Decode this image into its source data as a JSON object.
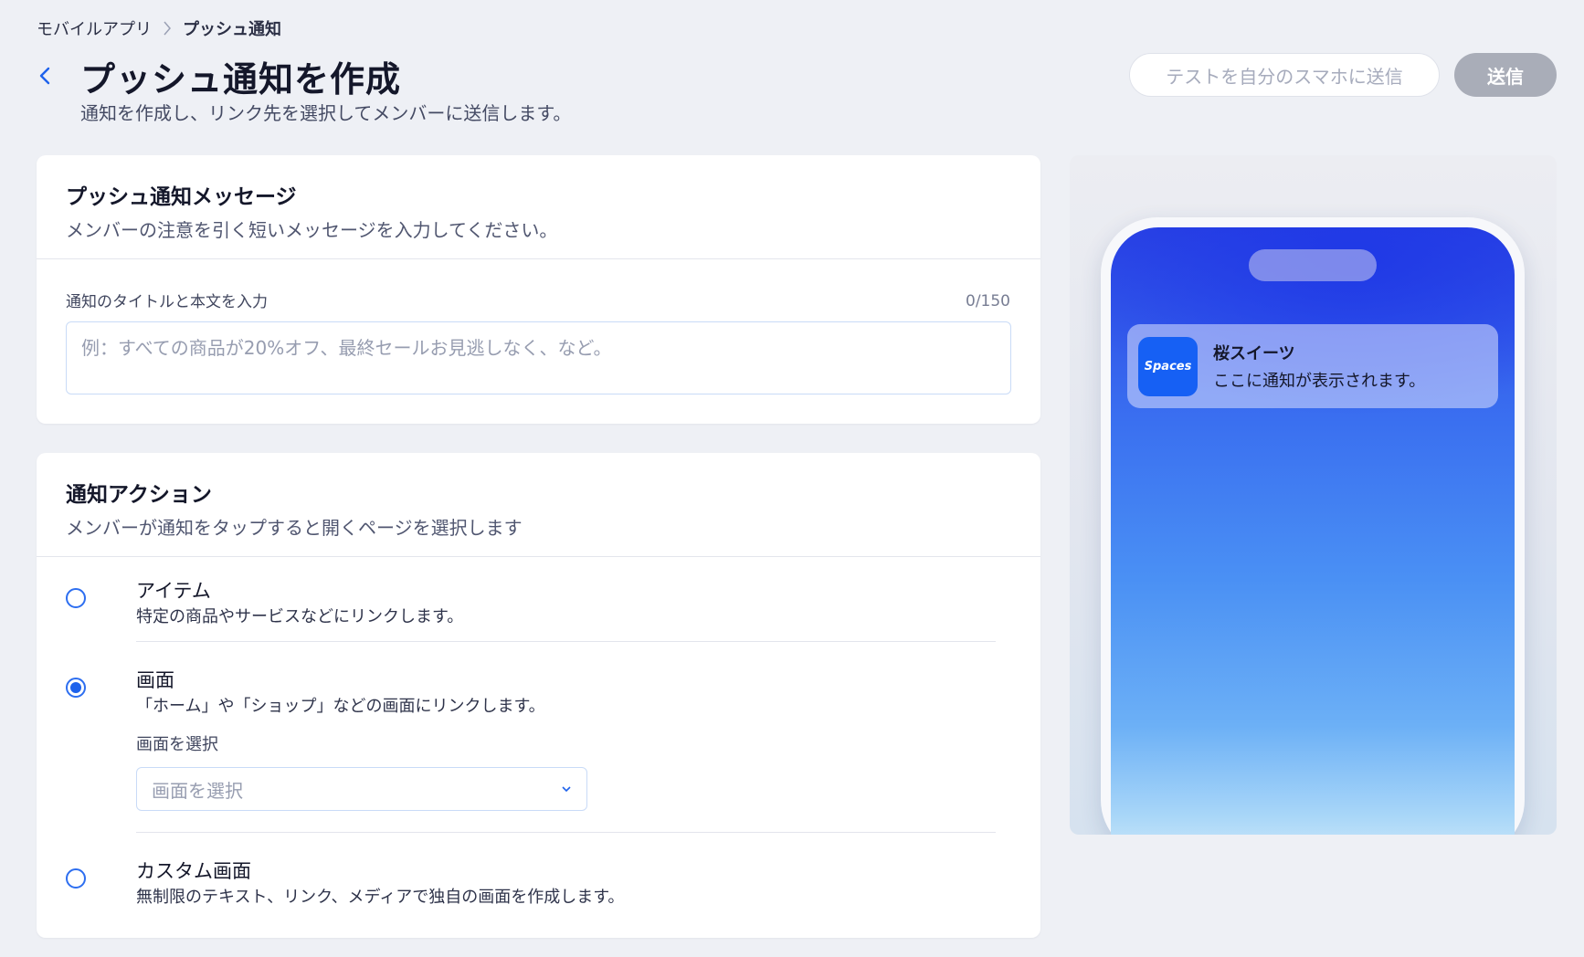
{
  "breadcrumb": {
    "parent": "モバイルアプリ",
    "separator": "〉",
    "current": "プッシュ通知"
  },
  "header": {
    "title": "プッシュ通知を作成",
    "subtitle": "通知を作成し、リンク先を選択してメンバーに送信します。",
    "test_button": "テストを自分のスマホに送信",
    "send_button": "送信"
  },
  "message_card": {
    "title": "プッシュ通知メッセージ",
    "description": "メンバーの注意を引く短いメッセージを入力してください。",
    "field_label": "通知のタイトルと本文を入力",
    "char_count": "0/150",
    "input_value": "",
    "input_placeholder": "例：すべての商品が20%オフ、最終セールお見逃しなく、など。"
  },
  "action_card": {
    "title": "通知アクション",
    "description": "メンバーが通知をタップすると開くページを選択します",
    "options": [
      {
        "title": "アイテム",
        "description": "特定の商品やサービスなどにリンクします。",
        "selected": false
      },
      {
        "title": "画面",
        "description": "「ホーム」や「ショップ」などの画面にリンクします。",
        "selected": true
      },
      {
        "title": "カスタム画面",
        "description": "無制限のテキスト、リンク、メディアで独自の画面を作成します。",
        "selected": false
      }
    ],
    "screen_select": {
      "label": "画面を選択",
      "placeholder": "画面を選択",
      "value": ""
    }
  },
  "preview": {
    "app_icon_text": "Spaces",
    "notification_title": "桜スイーツ",
    "notification_body": "ここに通知が表示されます。"
  },
  "colors": {
    "accent": "#1e62ec",
    "page_background": "#eef0f5",
    "send_button_disabled": "#a9adb8",
    "app_icon": "#1660f4"
  },
  "icons": {
    "back": "chevron-left-icon",
    "breadcrumb_separator": "chevron-right-icon",
    "dropdown": "chevron-down-icon"
  }
}
